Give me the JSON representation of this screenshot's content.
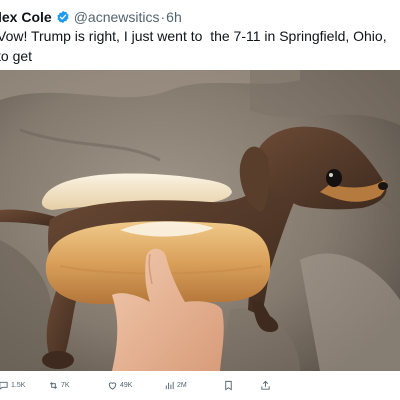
{
  "tweet": {
    "author_name": "lex Cole",
    "handle": "@acnewsitics",
    "separator": "·",
    "time": "6h",
    "text": "Vow! Trump is right, I just went to  the 7-11 in Springfield, Ohio, to get\nome gas and a hot dog.",
    "media_icon": "photo"
  },
  "actions": {
    "reply_count": "1.5K",
    "retweet_count": "7K",
    "like_count": "49K",
    "views_count": "2M"
  },
  "colors": {
    "text": "#0f1419",
    "secondary": "#536471",
    "verified": "#1d9bf0"
  }
}
